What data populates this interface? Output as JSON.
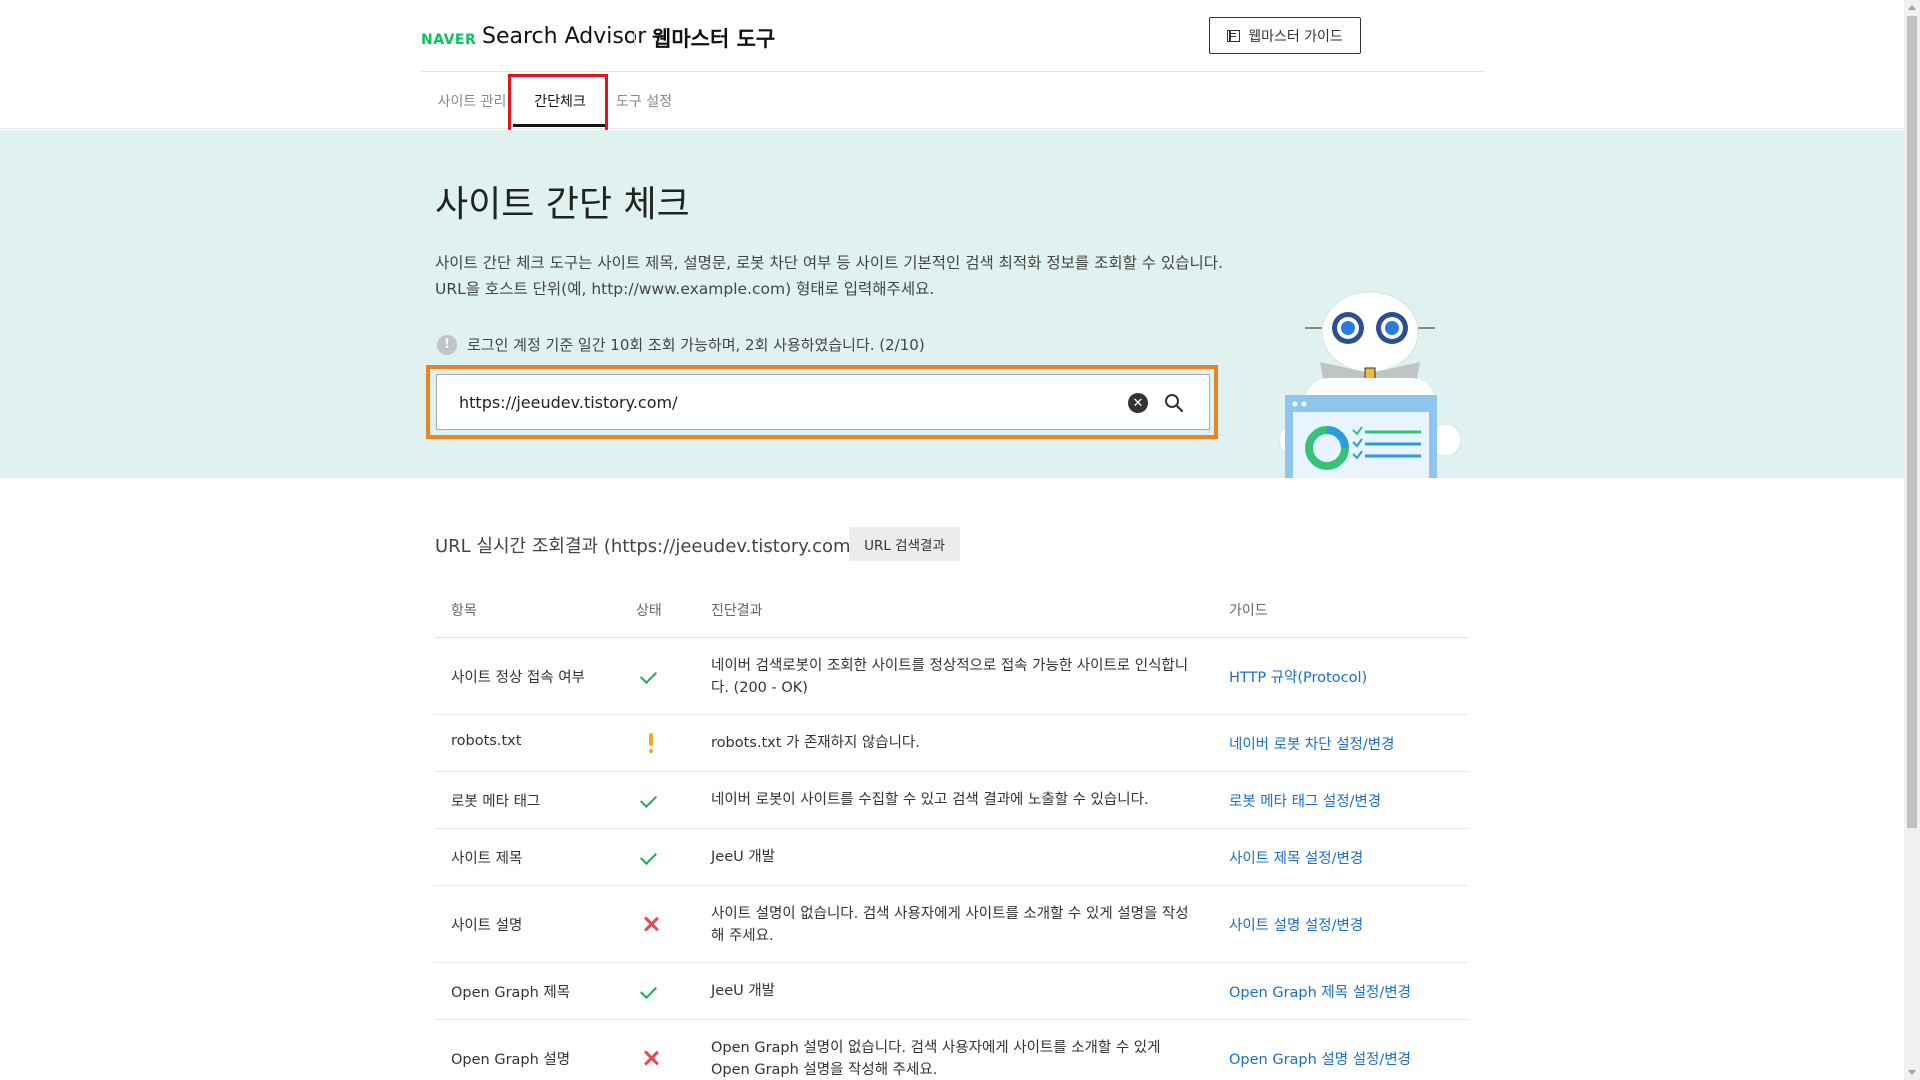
{
  "header": {
    "logo_naver": "NAVER",
    "logo_search_advisor": "Search Advisor",
    "logo_tool": "웹마스터 도구",
    "guide_button": "웹마스터 가이드"
  },
  "tabs": [
    {
      "label": "사이트 관리"
    },
    {
      "label": "간단체크"
    },
    {
      "label": "도구 설정"
    }
  ],
  "hero": {
    "title": "사이트 간단 체크",
    "desc_line1": "사이트 간단 체크 도구는 사이트 제목, 설명문, 로봇 차단 여부 등 사이트 기본적인 검색 최적화 정보를 조회할 수 있습니다.",
    "desc_line2": "URL을 호스트 단위(예, http://www.example.com) 형태로 입력해주세요.",
    "info_text": "로그인 계정 기준 일간 10회 조회 가능하며, 2회 사용하였습니다. (2/10)",
    "search_value": "https://jeeudev.tistory.com/"
  },
  "results": {
    "title": "URL 실시간 조회결과 (https://jeeudev.tistory.com/)",
    "url_button": "URL 검색결과",
    "columns": [
      "항목",
      "상태",
      "진단결과",
      "가이드"
    ],
    "rows": [
      {
        "item": "사이트 정상 접속 여부",
        "status": "ok",
        "result": "네이버 검색로봇이 조회한 사이트를 정상적으로 접속 가능한 사이트로 인식합니다. (200 - OK)",
        "guide": "HTTP 규약(Protocol)"
      },
      {
        "item": "robots.txt",
        "status": "warn",
        "result": "robots.txt 가 존재하지 않습니다.",
        "guide": "네이버 로봇 차단 설정/변경"
      },
      {
        "item": "로봇 메타 태그",
        "status": "ok",
        "result": "네이버 로봇이 사이트를 수집할 수 있고 검색 결과에 노출할 수 있습니다.",
        "guide": "로봇 메타 태그 설정/변경"
      },
      {
        "item": "사이트 제목",
        "status": "ok",
        "result": "JeeU 개발",
        "guide": "사이트 제목 설정/변경"
      },
      {
        "item": "사이트 설명",
        "status": "error",
        "result": "사이트 설명이 없습니다. 검색 사용자에게 사이트를 소개할 수 있게 설명을 작성해 주세요.",
        "guide": "사이트 설명 설정/변경"
      },
      {
        "item": "Open Graph 제목",
        "status": "ok",
        "result": "JeeU 개발",
        "guide": "Open Graph 제목 설정/변경"
      },
      {
        "item": "Open Graph 설명",
        "status": "error",
        "result": "Open Graph 설명이 없습니다. 검색 사용자에게 사이트를 소개할 수 있게 Open Graph 설명을 작성해 주세요.",
        "guide": "Open Graph 설명 설정/변경"
      }
    ]
  },
  "icons": {
    "info": "info-icon",
    "clear": "clear-icon",
    "search": "search-icon",
    "ok": "check-icon",
    "warn": "warning-icon",
    "error": "x-icon"
  },
  "colors": {
    "naver_green": "#03c75a",
    "hero_bg": "#dff2f0",
    "tab_highlight": "#e3141f",
    "search_highlight": "#f08226",
    "link": "#1a6fc9",
    "ok": "#1faa59",
    "warn": "#f5a623",
    "error": "#e8474c"
  }
}
